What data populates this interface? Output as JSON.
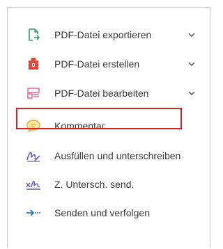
{
  "tools": [
    {
      "label": "PDF-Datei exportieren",
      "icon": "export-pdf-icon",
      "expandable": true
    },
    {
      "label": "PDF-Datei erstellen",
      "icon": "create-pdf-icon",
      "expandable": true
    },
    {
      "label": "PDF-Datei bearbeiten",
      "icon": "edit-pdf-icon",
      "expandable": true
    },
    {
      "label": "Kommentar",
      "icon": "comment-icon",
      "expandable": false,
      "highlighted": true
    },
    {
      "label": "Ausfüllen und unterschreiben",
      "icon": "fill-sign-icon",
      "expandable": false
    },
    {
      "label": "Z. Untersch. send.",
      "icon": "send-signature-icon",
      "expandable": false
    },
    {
      "label": "Senden und verfolgen",
      "icon": "send-track-icon",
      "expandable": false
    }
  ],
  "colors": {
    "export": "#2e9e6b",
    "create": "#e5453b",
    "edit": "#e86a9a",
    "comment": "#f2b233",
    "sign": "#6b5fc4",
    "send": "#1a73c9",
    "highlight": "#e02020",
    "text": "#3b3b3b"
  }
}
